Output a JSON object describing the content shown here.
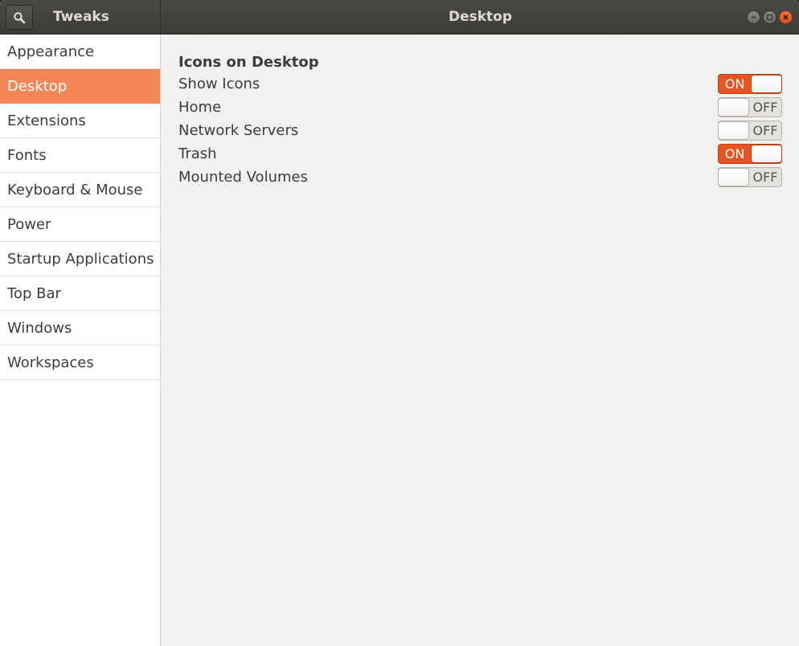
{
  "header": {
    "app_title": "Tweaks",
    "page_title": "Desktop"
  },
  "sidebar": {
    "items": [
      {
        "label": "Appearance",
        "selected": false
      },
      {
        "label": "Desktop",
        "selected": true
      },
      {
        "label": "Extensions",
        "selected": false
      },
      {
        "label": "Fonts",
        "selected": false
      },
      {
        "label": "Keyboard & Mouse",
        "selected": false
      },
      {
        "label": "Power",
        "selected": false
      },
      {
        "label": "Startup Applications",
        "selected": false
      },
      {
        "label": "Top Bar",
        "selected": false
      },
      {
        "label": "Windows",
        "selected": false
      },
      {
        "label": "Workspaces",
        "selected": false
      }
    ]
  },
  "content": {
    "section_title": "Icons on Desktop",
    "settings": [
      {
        "label": "Show Icons",
        "state": "ON"
      },
      {
        "label": "Home",
        "state": "OFF"
      },
      {
        "label": "Network Servers",
        "state": "OFF"
      },
      {
        "label": "Trash",
        "state": "ON"
      },
      {
        "label": "Mounted Volumes",
        "state": "OFF"
      }
    ]
  },
  "colors": {
    "accent": "#e95420",
    "selection": "#f48655"
  },
  "icons": {
    "search": "search-icon",
    "minimize": "minimize-icon",
    "maximize": "maximize-icon",
    "close": "close-icon"
  }
}
